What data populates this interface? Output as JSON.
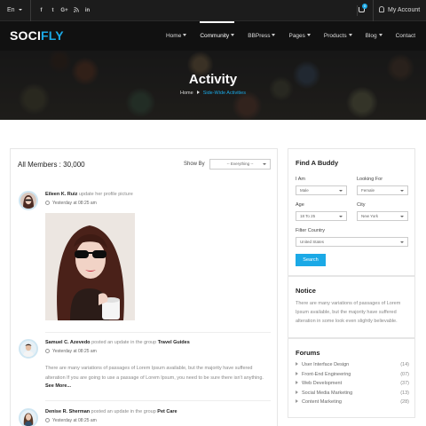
{
  "topbar": {
    "language": "En",
    "social_icons": [
      "f",
      "t",
      "G+",
      "rss",
      "in"
    ],
    "cart_count": "0",
    "account_label": "My Account"
  },
  "nav": {
    "logo_main": "SOCI",
    "logo_accent": "FLY",
    "items": [
      {
        "label": "Home",
        "has_caret": true,
        "active": false
      },
      {
        "label": "Community",
        "has_caret": true,
        "active": true
      },
      {
        "label": "BBPress",
        "has_caret": true,
        "active": false
      },
      {
        "label": "Pages",
        "has_caret": true,
        "active": false
      },
      {
        "label": "Products",
        "has_caret": true,
        "active": false
      },
      {
        "label": "Blog",
        "has_caret": true,
        "active": false
      },
      {
        "label": "Contact",
        "has_caret": false,
        "active": false
      }
    ]
  },
  "hero": {
    "title": "Activity",
    "crumb_home": "Home",
    "crumb_current": "Side-Wide Activities"
  },
  "main": {
    "members_title": "All Members : 30,000",
    "showby_label": "Show By",
    "showby_value": "-- Everything --",
    "posts": [
      {
        "author": "Eileen K. Ruiz",
        "action": "update her profile picture",
        "group": "",
        "time": "Yesterday at 08:25 am",
        "text": "",
        "more": ""
      },
      {
        "author": "Samuel C. Azevedo",
        "action": "posted an update in the group",
        "group": "Travel Guides",
        "time": "Yesterday at 08:25 am",
        "text": "There are many variations of passages of Lorem Ipsum available, but the majority have suffered alteration If you are going to use a passage of Lorem Ipsum, you need to be sure there isn't anything.",
        "more": "See More..."
      },
      {
        "author": "Denise R. Sherman",
        "action": "posted an update in the group",
        "group": "Pet Care",
        "time": "Yesterday at 08:25 am",
        "text": "",
        "more": ""
      }
    ]
  },
  "find_buddy": {
    "title": "Find A Buddy",
    "i_am_label": "I Am",
    "i_am_value": "Male",
    "looking_for_label": "Looking For",
    "looking_for_value": "Female",
    "age_label": "Age",
    "age_value": "18 To 25",
    "city_label": "City",
    "city_value": "New York",
    "country_label": "Filter Country",
    "country_value": "United States",
    "search_label": "Search"
  },
  "notice": {
    "title": "Notice",
    "text": "There are many variations of passages of Lorem Ipsum available, but the majority have suffered alteration in some look even slightly believable."
  },
  "forums": {
    "title": "Forums",
    "items": [
      {
        "label": "User Interface Design",
        "count": "(14)"
      },
      {
        "label": "Front-End Engineering",
        "count": "(07)"
      },
      {
        "label": "Web Development",
        "count": "(37)"
      },
      {
        "label": "Social Media Marketing",
        "count": "(13)"
      },
      {
        "label": "Content Marketing",
        "count": "(28)"
      }
    ]
  },
  "colors": {
    "accent": "#1ba9e6",
    "nav_bg": "#111111",
    "topbar_bg": "#1c1c1c"
  }
}
